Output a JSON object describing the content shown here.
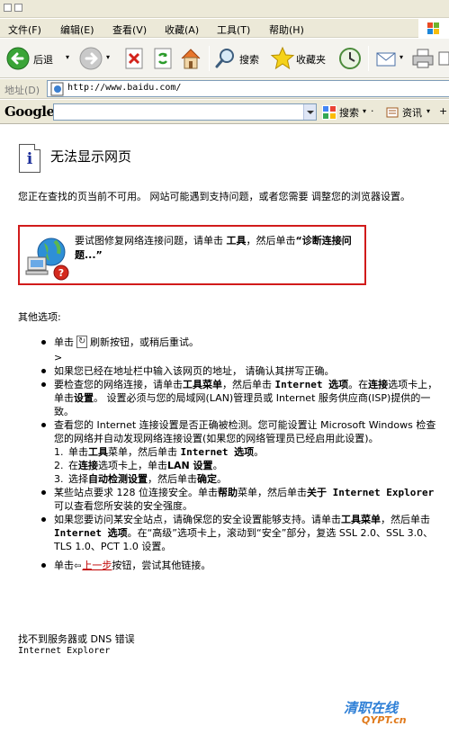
{
  "menu": {
    "items": [
      "文件(F)",
      "编辑(E)",
      "查看(V)",
      "收藏(A)",
      "工具(T)",
      "帮助(H)"
    ]
  },
  "toolbar": {
    "back_label": "后退",
    "search_label": "搜索",
    "favorites_label": "收藏夹"
  },
  "address": {
    "label": "地址(D)",
    "url": "http://www.baidu.com/"
  },
  "googlebar": {
    "logo": "Google",
    "search_button": "搜索",
    "news_button": "资讯"
  },
  "page": {
    "title": "无法显示网页",
    "intro": "您正在查找的页当前不可用。 网站可能遇到支持问题，或者您需要 调整您的浏览器设置。",
    "diag": {
      "pre": "要试图修复网络连接问题，请单击",
      "tools": "工具",
      "mid": "，然后单击",
      "diagnose": "“诊断连接问题...”"
    },
    "other_title": "其他选项:",
    "items": {
      "refresh_pre": "单击",
      "refresh_post": "刷新按钮，或稍后重试。",
      "refresh_extra": ">",
      "address_check": "如果您已经在地址栏中输入该网页的地址， 请确认其拼写正确。",
      "net1": "要检查您的网络连接，请单击",
      "net_tools_menu": "工具菜单",
      "net2": "，然后单击",
      "net_ieoptions": "Internet 选项",
      "net3": "。在",
      "net_conn_tab": "连接",
      "net4": "选项卡上，单击",
      "net_settings": "设置",
      "net5": "。 设置必须与您的局域网(LAN)管理员或 Internet 服务供应商(ISP)提供的一致。",
      "detect": "查看您的 Internet 连接设置是否正确被检测。您可能设置让 Microsoft Windows 检查您的网络并自动发现网络连接设置(如果您的网络管理员已经启用此设置)。",
      "step1_num": "1.",
      "step1_a": "单击",
      "step1_tools": "工具",
      "step1_b": "菜单，然后单击",
      "step1_ie": "Internet 选项",
      "step1_c": "。",
      "step2_num": "2.",
      "step2_a": "在",
      "step2_conn": "连接",
      "step2_b": "选项卡上，单击",
      "step2_lan": "LAN 设置",
      "step2_c": "。",
      "step3_num": "3.",
      "step3_a": "选择",
      "step3_auto": "自动检测设置",
      "step3_b": "，然后单击",
      "step3_ok": "确定",
      "step3_c": "。",
      "ssl1": "某些站点要求 128 位连接安全。单击",
      "ssl_help": "帮助",
      "ssl2": "菜单，然后单击",
      "ssl_about": "关于 Internet Explorer",
      "ssl3": " 可以查看您所安装的安全强度。",
      "sec1": "如果您要访问某安全站点，请确保您的安全设置能够支持。请单击",
      "sec_tools": "工具菜单",
      "sec2": "，然后单击",
      "sec_ie": "Internet 选项",
      "sec3": "。在“高级”选项卡上，滚动到“安全”部分，复选 SSL 2.0、SSL 3.0、TLS 1.0、PCT 1.0 设置。",
      "back_pre": "单击",
      "back_link": "上一步",
      "back_post": "按钮，尝试其他链接。"
    },
    "footer_error": "找不到服务器或 DNS 错误",
    "footer_product": "Internet Explorer"
  },
  "watermark": {
    "line1": "清职在线",
    "line2": "QYPT.cn"
  },
  "colors": {
    "diag_border": "#d11b1b",
    "link": "#c00000",
    "chrome": "#ece9d8"
  }
}
